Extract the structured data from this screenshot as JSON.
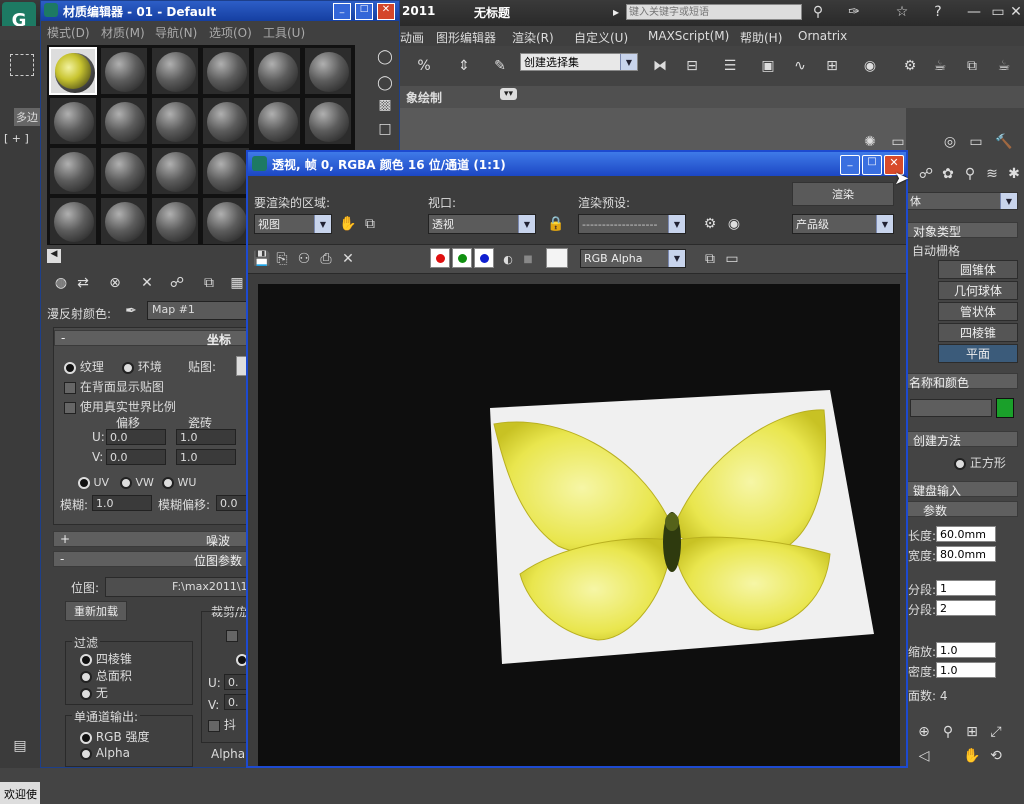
{
  "main": {
    "title": "无标题",
    "version": "2011",
    "search_placeholder": "键入关键字或短语",
    "menus": [
      "动画",
      "图形编辑器",
      "渲染(R)",
      "自定义(U)",
      "MAXScript(M)",
      "帮助(H)",
      "Ornatrix"
    ],
    "selection_set": "创建选择集",
    "ribbon_label": "象绘制",
    "viewport_label": "[ + ]",
    "left_label": "多边",
    "status_text": "欢迎使"
  },
  "material_editor": {
    "title": "材质编辑器 - 01 - Default",
    "menus": [
      "模式(D)",
      "材质(M)",
      "导航(N)",
      "选项(O)",
      "工具(U)"
    ],
    "diffuse_label": "漫反射颜色:",
    "map_name": "Map #1",
    "coords": {
      "header": "坐标",
      "texture_label": "纹理",
      "env_label": "环境",
      "mapping_label": "贴图:",
      "show_back_label": "在背面显示贴图",
      "real_world_label": "使用真实世界比例",
      "offset_label": "偏移",
      "tiling_label": "瓷砖",
      "u_label": "U:",
      "v_label": "V:",
      "u_offset": "0.0",
      "v_offset": "0.0",
      "u_tiling": "1.0",
      "v_tiling": "1.0",
      "uv_label": "UV",
      "vw_label": "VW",
      "wu_label": "WU",
      "blur_label": "模糊:",
      "blur_value": "1.0",
      "blur_offset_label": "模糊偏移:",
      "blur_offset_value": "0.0"
    },
    "noise_header": "噪波",
    "bitmap": {
      "header": "位图参数",
      "bitmap_label": "位图:",
      "bitmap_path": "F:\\max2011\\1-",
      "reload_label": "重新加载",
      "crop_label": "裁剪/放",
      "filter_label": "过滤",
      "filter_options": [
        "四棱锥",
        "总面积",
        "无"
      ],
      "mono_label": "单通道输出:",
      "mono_options": [
        "RGB 强度",
        "Alpha"
      ],
      "alpha_label": "Alpha",
      "crop_u_label": "U:",
      "crop_v_label": "V:",
      "crop_u": "0.",
      "crop_v": "0.",
      "jitter_label": "抖"
    }
  },
  "render_window": {
    "title": "透视, 帧 0, RGBA 颜色 16 位/通道 (1:1)",
    "area_label": "要渲染的区域:",
    "area_value": "视图",
    "viewport_label": "视口:",
    "viewport_value": "透视",
    "preset_label": "渲染预设:",
    "preset_value": "-------------------",
    "render_button": "渲染",
    "quality_value": "产品级",
    "channel_value": "RGB Alpha",
    "colors": {
      "red": "#e01010",
      "green": "#109010",
      "blue": "#1020d0",
      "white": "#f4f4f4"
    }
  },
  "command_panel": {
    "object_type_label": "对象类型",
    "auto_grid_label": "自动栅格",
    "buttons": [
      "圆锥体",
      "几何球体",
      "管状体",
      "四棱锥",
      "平面"
    ],
    "name_color_label": "名称和颜色",
    "object_color": "#1aa02a",
    "creation_method_label": "创建方法",
    "creation_option": "正方形",
    "keyboard_entry_label": "键盘输入",
    "params_label": "参数",
    "length_label": "长度:",
    "length_value": "60.0mm",
    "width_label": "宽度:",
    "width_value": "80.0mm",
    "length_segs_label": "分段:",
    "length_segs": "1",
    "width_segs_label": "分段:",
    "width_segs": "2",
    "render_scale_label": "缩放:",
    "render_scale": "1.0",
    "density_label": "密度:",
    "density": "1.0",
    "faces_label": "面数: 4"
  }
}
